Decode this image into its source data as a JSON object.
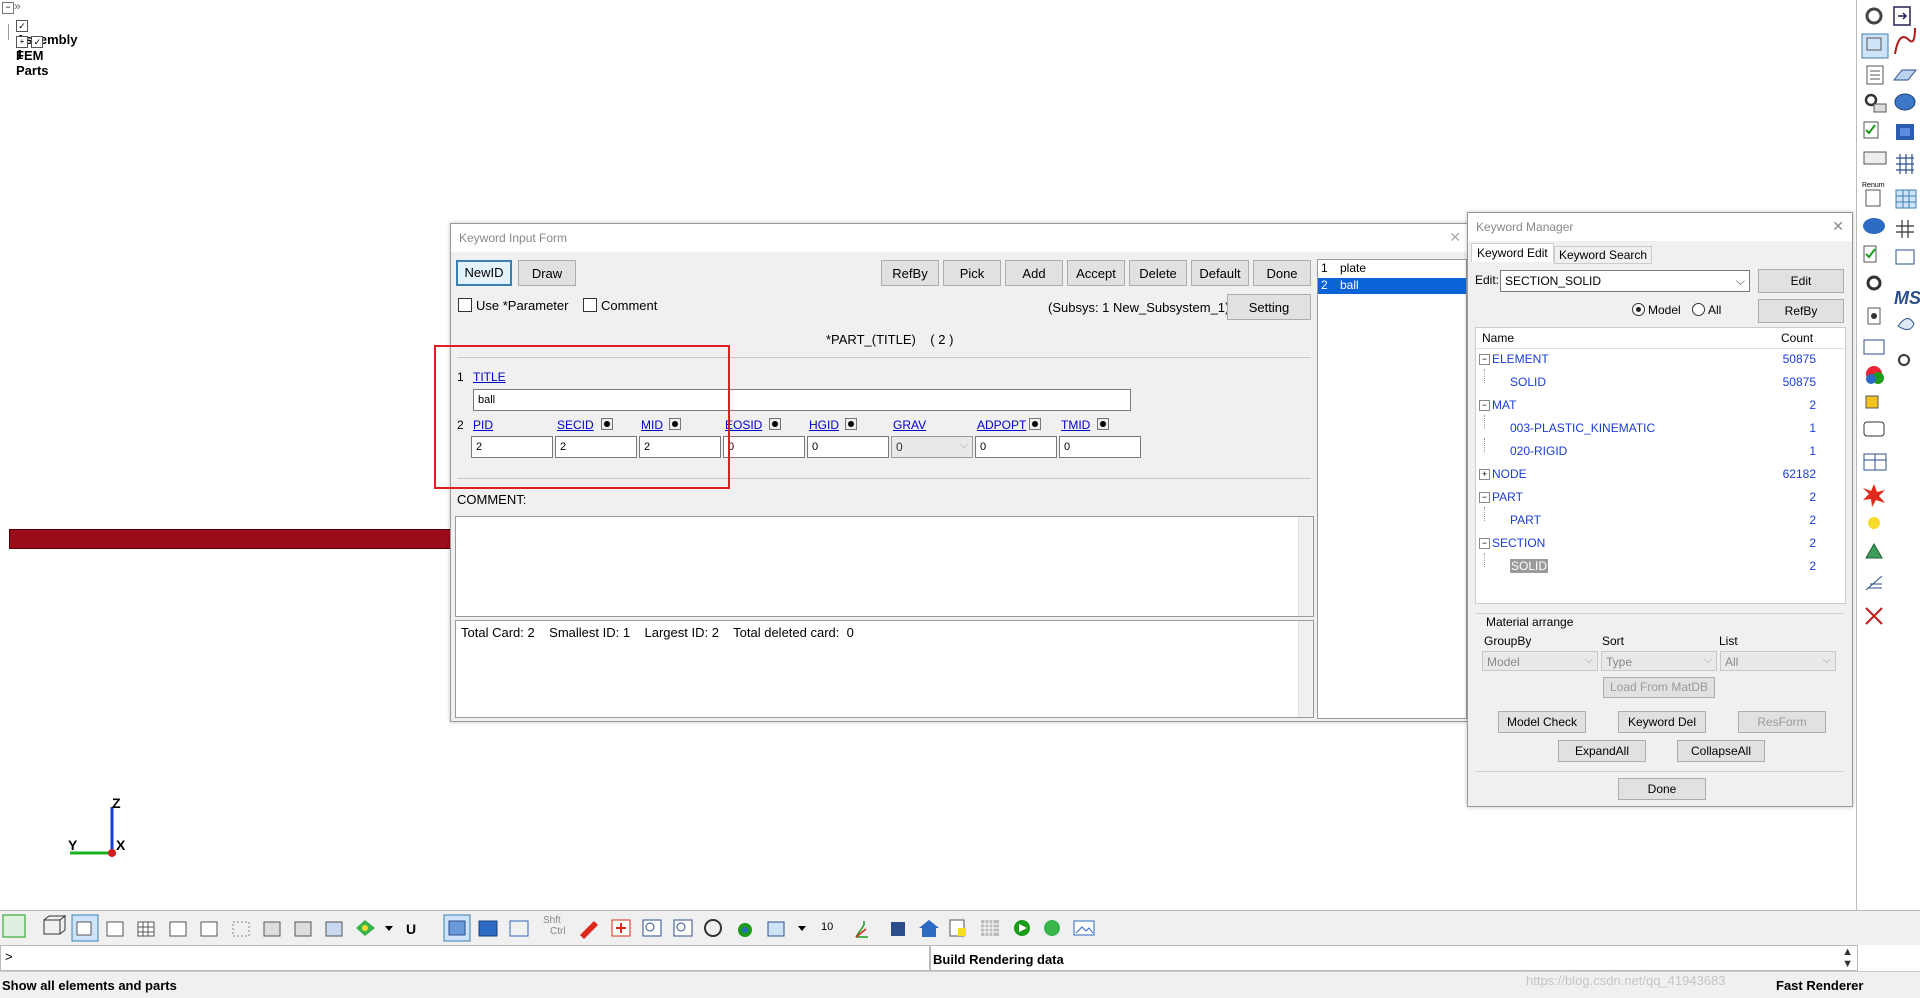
{
  "tree": {
    "assembly": "Assembly 1",
    "fem_parts": "FEM Parts"
  },
  "axes": {
    "z": "Z",
    "y": "Y",
    "x": "X"
  },
  "kif": {
    "title": "Keyword Input Form",
    "buttons": {
      "newid": "NewID",
      "draw": "Draw",
      "refby": "RefBy",
      "pick": "Pick",
      "add": "Add",
      "accept": "Accept",
      "delete": "Delete",
      "default": "Default",
      "done": "Done",
      "setting": "Setting"
    },
    "use_parameter": "Use *Parameter",
    "comment_check": "Comment",
    "subsys": "(Subsys: 1 New_Subsystem_1)",
    "keyword_header": "*PART_(TITLE)",
    "keyword_count": "( 2 )",
    "card1_num": "1",
    "title_label": "TITLE",
    "title_value": "ball",
    "card2_num": "2",
    "fields": [
      {
        "label": "PID",
        "value": "2"
      },
      {
        "label": "SECID",
        "value": "2"
      },
      {
        "label": "MID",
        "value": "2"
      },
      {
        "label": "EOSID",
        "value": "0"
      },
      {
        "label": "HGID",
        "value": "0"
      },
      {
        "label": "GRAV",
        "value": "0"
      },
      {
        "label": "ADPOPT",
        "value": "0"
      },
      {
        "label": "TMID",
        "value": "0"
      }
    ],
    "comment_label": "COMMENT:",
    "stats": "Total Card: 2    Smallest ID: 1    Largest ID: 2    Total deleted card:  0",
    "list": [
      {
        "num": "1",
        "name": "plate"
      },
      {
        "num": "2",
        "name": "ball"
      }
    ]
  },
  "km": {
    "title": "Keyword Manager",
    "tab_edit": "Keyword Edit",
    "tab_search": "Keyword Search",
    "edit_label": "Edit:",
    "edit_value": "SECTION_SOLID",
    "edit_btn": "Edit",
    "radio_model": "Model",
    "radio_all": "All",
    "refby_btn": "RefBy",
    "col_name": "Name",
    "col_count": "Count",
    "rows": [
      {
        "name": "ELEMENT",
        "count": "50875"
      },
      {
        "name": "SOLID",
        "count": "50875"
      },
      {
        "name": "MAT",
        "count": "2"
      },
      {
        "name": "003-PLASTIC_KINEMATIC",
        "count": "1"
      },
      {
        "name": "020-RIGID",
        "count": "1"
      },
      {
        "name": "NODE",
        "count": "62182"
      },
      {
        "name": "PART",
        "count": "2"
      },
      {
        "name": "PART",
        "count": "2"
      },
      {
        "name": "SECTION",
        "count": "2"
      },
      {
        "name": "SOLID",
        "count": "2"
      }
    ],
    "material_arrange": "Material arrange",
    "groupby_label": "GroupBy",
    "sort_label": "Sort",
    "list_label": "List",
    "groupby_value": "Model",
    "sort_value": "Type",
    "list_value": "All",
    "load_matdb": "Load From MatDB",
    "model_check": "Model Check",
    "keyword_del": "Keyword Del",
    "resform": "ResForm",
    "expand_all": "ExpandAll",
    "collapse_all": "CollapseAll",
    "done": "Done"
  },
  "bottom": {
    "prompt": ">",
    "build_status": "Build Rendering data",
    "status_left": "Show all elements and parts",
    "renderer": "Fast Renderer",
    "watermark": "https://blog.csdn.net/qq_41943683",
    "shft": "Shft",
    "ctrl": "Ctrl",
    "u_label": "U",
    "ten_label": "10"
  },
  "sidebar": {
    "ms_label": "MS",
    "renum_label": "Renum"
  },
  "colors": {
    "beam": "#9b0c1b",
    "highlight_box": "#e31b23",
    "selection": "#0a64d8"
  }
}
